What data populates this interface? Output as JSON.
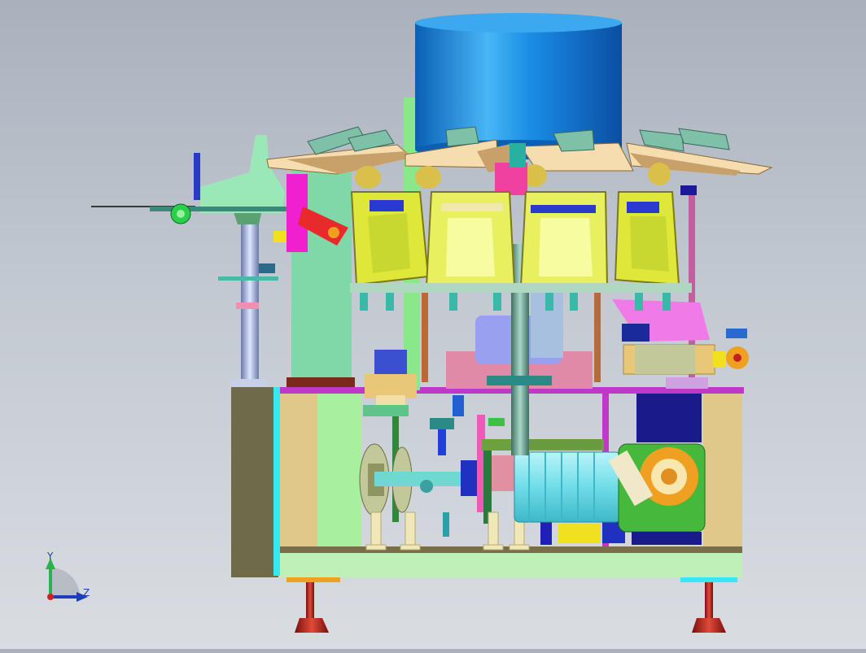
{
  "viewport": {
    "model": "rotary-packing-machine-assembly",
    "view": "front"
  },
  "triad": {
    "axis_y": "Y",
    "axis_z": "Z",
    "colors": {
      "y": "#2ab34a",
      "z": "#1b3fb8",
      "x": "#d02020"
    }
  },
  "colors": {
    "hopper": "#1f8fe0",
    "trays": "#e8c98a",
    "buckets": "#d8e84a",
    "frame_top": "#c040c0",
    "motor": "#7fe8f0",
    "gearbox": "#46b83c",
    "feet": "#c0201c"
  }
}
